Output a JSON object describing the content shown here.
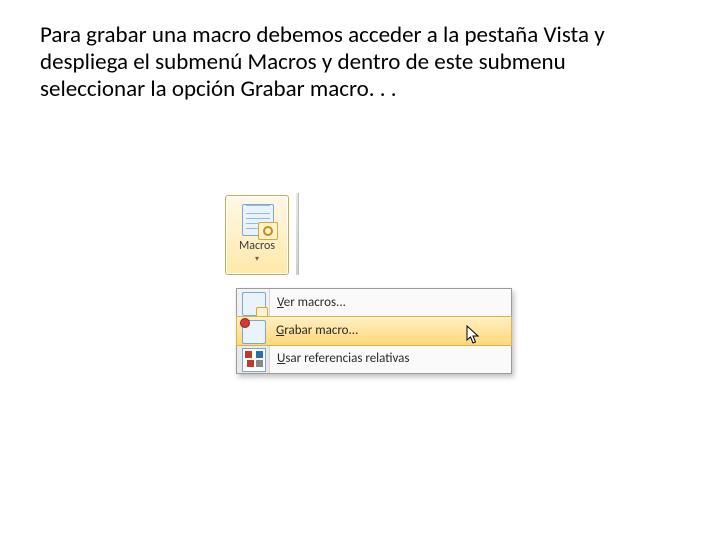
{
  "instruction": "Para grabar una macro debemos acceder a la pestaña Vista y despliega el submenú Macros y dentro de este submenu seleccionar la opción Grabar macro. . .",
  "ribbon": {
    "macros_label": "Macros",
    "dropdown_glyph": "▾"
  },
  "menu": {
    "items": [
      {
        "icon": "macros-view-icon",
        "pre": "",
        "u": "V",
        "post": "er macros..."
      },
      {
        "icon": "macros-record-icon",
        "pre": "",
        "u": "G",
        "post": "rabar macro..."
      },
      {
        "icon": "macros-relative-icon",
        "pre": "",
        "u": "U",
        "post": "sar referencias relativas"
      }
    ],
    "hover_index": 1
  }
}
